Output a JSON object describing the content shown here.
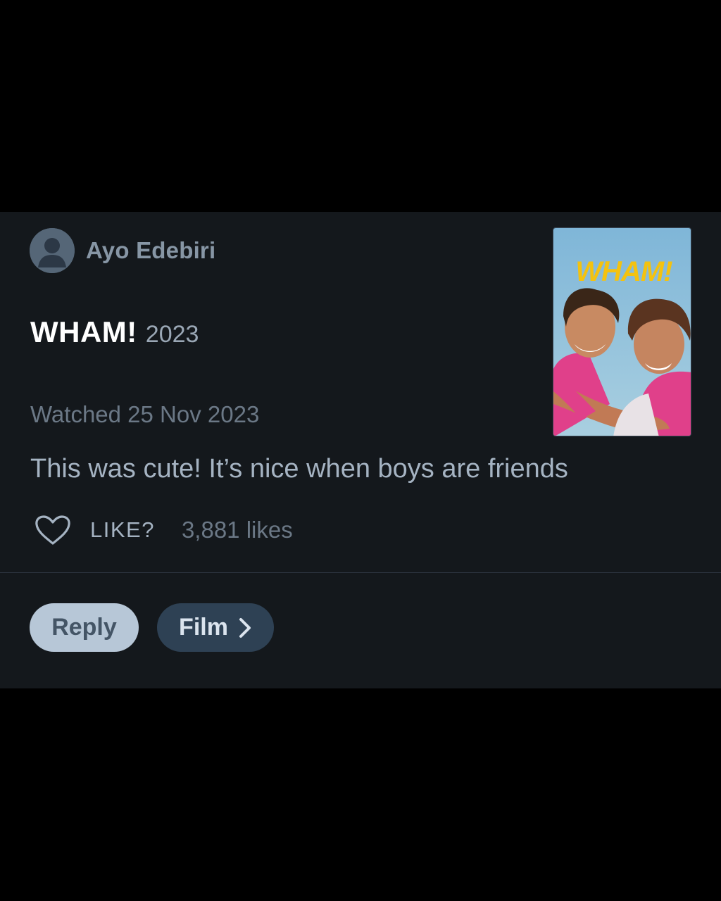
{
  "review": {
    "username": "Ayo Edebiri",
    "film_title": "WHAM!",
    "film_year": "2023",
    "watched": "Watched 25 Nov 2023",
    "text": "This was cute! It’s nice when boys are friends",
    "like_label": "LIKE?",
    "like_count": "3,881 likes",
    "poster_title": "WHAM!"
  },
  "actions": {
    "reply_label": "Reply",
    "film_label": "Film"
  },
  "icons": {
    "avatar": "user-avatar-icon",
    "like": "heart-outline-icon",
    "film_chevron": "chevron-right-icon"
  },
  "colors": {
    "background": "#000000",
    "card": "#14181c",
    "reply_button": "#b7c7d7",
    "film_button": "#2e4154",
    "muted_text": "#6b7886"
  }
}
